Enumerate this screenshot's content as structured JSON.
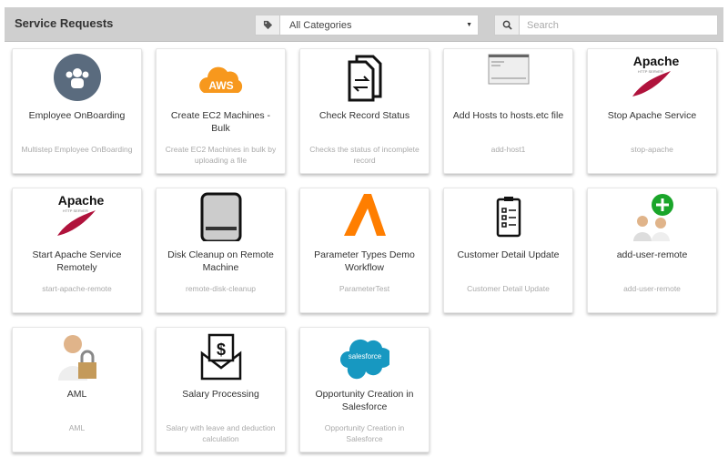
{
  "header": {
    "title": "Service Requests",
    "category": "All Categories",
    "search_placeholder": "Search"
  },
  "cards": [
    {
      "title": "Employee OnBoarding",
      "desc": "Multistep Employee OnBoarding",
      "icon": "users-icon"
    },
    {
      "title": "Create EC2 Machines - Bulk",
      "desc": "Create EC2 Machines in bulk by uploading a file",
      "icon": "aws-icon",
      "icon_text": "AWS"
    },
    {
      "title": "Check Record Status",
      "desc": "Checks the status of incomplete record",
      "icon": "documents-swap-icon"
    },
    {
      "title": "Add Hosts to hosts.etc file",
      "desc": "add-host1",
      "icon": "terminal-screenshot-icon"
    },
    {
      "title": "Stop Apache Service",
      "desc": "stop-apache",
      "icon": "apache-icon",
      "icon_text": "Apache"
    },
    {
      "title": "Start Apache Service Remotely",
      "desc": "start-apache-remote",
      "icon": "apache-icon",
      "icon_text": "Apache"
    },
    {
      "title": "Disk Cleanup on Remote Machine",
      "desc": "remote-disk-cleanup",
      "icon": "hard-drive-icon"
    },
    {
      "title": "Parameter Types Demo Workflow",
      "desc": "ParameterTest",
      "icon": "logo-a-icon"
    },
    {
      "title": "Customer Detail Update",
      "desc": "Customer Detail Update",
      "icon": "clipboard-checklist-icon"
    },
    {
      "title": "add-user-remote",
      "desc": "add-user-remote",
      "icon": "add-user-icon"
    },
    {
      "title": "AML",
      "desc": "AML",
      "icon": "user-lock-icon"
    },
    {
      "title": "Salary Processing",
      "desc": "Salary with leave and deduction calculation",
      "icon": "salary-envelope-icon"
    },
    {
      "title": "Opportunity Creation in Salesforce",
      "desc": "Opportunity Creation in Salesforce",
      "icon": "salesforce-icon",
      "icon_text": "salesforce"
    }
  ]
}
